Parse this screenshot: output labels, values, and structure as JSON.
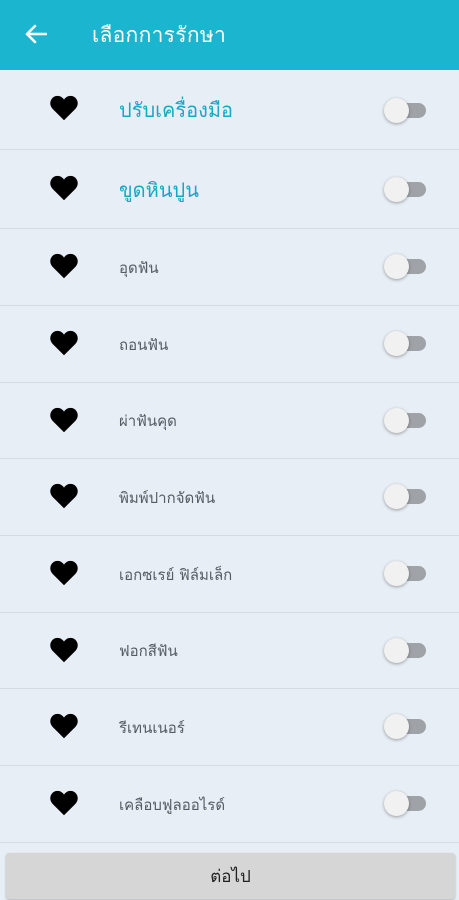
{
  "header": {
    "title": "เลือกการรักษา",
    "back_icon": "arrow-left-icon",
    "background_color": "#1cb5cf"
  },
  "treatments": [
    {
      "label": "ปรับเครื่องมือ",
      "icon": "heart-icon",
      "enabled": false
    },
    {
      "label": "ขูดหินปูน",
      "icon": "heart-icon",
      "enabled": false
    },
    {
      "label": "อุดฟัน",
      "icon": "heart-icon",
      "enabled": false
    },
    {
      "label": "ถอนฟัน",
      "icon": "heart-icon",
      "enabled": false
    },
    {
      "label": "ผ่าฟันคุด",
      "icon": "heart-icon",
      "enabled": false
    },
    {
      "label": "พิมพ์ปากจัดฟัน",
      "icon": "heart-icon",
      "enabled": false
    },
    {
      "label": "เอกซเรย์ ฟิล์มเล็ก",
      "icon": "heart-icon",
      "enabled": false
    },
    {
      "label": "ฟอกสีฟัน",
      "icon": "heart-icon",
      "enabled": false
    },
    {
      "label": "รีเทนเนอร์",
      "icon": "heart-icon",
      "enabled": false
    },
    {
      "label": "เคลือบฟูลออไรด์",
      "icon": "heart-icon",
      "enabled": false
    }
  ],
  "footer": {
    "next_label": "ต่อไป"
  },
  "colors": {
    "accent": "#1cb5cf",
    "highlight_text": "#17a8c4",
    "list_background": "#e8eef5"
  }
}
